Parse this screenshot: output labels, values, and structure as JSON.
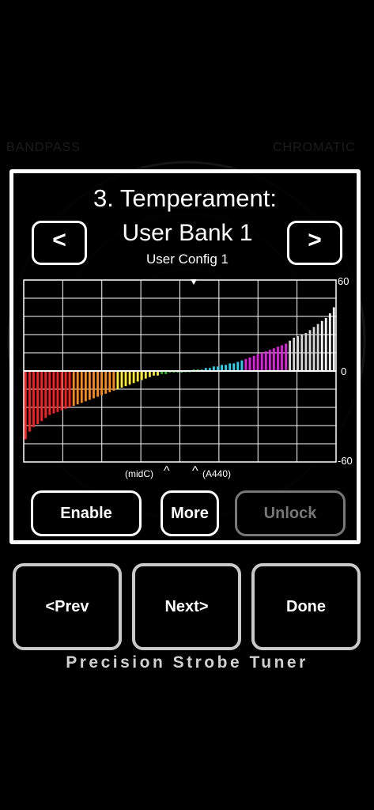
{
  "background": {
    "left_label": "BANDPASS",
    "right_label": "CHROMATIC"
  },
  "dialog": {
    "title": "3. Temperament:",
    "bank_name": "User Bank 1",
    "config_name": "User Config 1",
    "prev_arrow": "<",
    "next_arrow": ">",
    "enable_label": "Enable",
    "more_label": "More",
    "unlock_label": "Unlock"
  },
  "chart_data": {
    "type": "bar",
    "ytick_labels": [
      "60",
      "0",
      "-60"
    ],
    "ylim": [
      -60,
      60
    ],
    "grid": true,
    "marker_labels": [
      "(midC)",
      "(A440)"
    ],
    "bar_count": 78,
    "values": [
      -45,
      -40,
      -37,
      -35,
      -33,
      -31,
      -29,
      -28,
      -27,
      -26,
      -25,
      -24,
      -23,
      -22,
      -21,
      -20,
      -19,
      -18,
      -17,
      -16,
      -15,
      -14,
      -13,
      -12,
      -11,
      -10,
      -9,
      -8,
      -7,
      -6,
      -5,
      -4,
      -3,
      -3,
      -2,
      -2,
      -1,
      -1,
      -1,
      -1,
      0,
      0,
      1,
      1,
      1,
      2,
      2,
      3,
      3,
      4,
      4,
      5,
      5,
      6,
      7,
      8,
      9,
      10,
      11,
      12,
      13,
      14,
      15,
      16,
      17,
      18,
      20,
      22,
      23,
      24,
      25,
      27,
      29,
      31,
      33,
      35,
      38,
      42
    ],
    "series_colors": [
      {
        "color": "#ff1e1e",
        "count": 12
      },
      {
        "color": "#ff8a10",
        "count": 11
      },
      {
        "color": "#ffee22",
        "count": 11
      },
      {
        "color": "#22d41e",
        "count": 10
      },
      {
        "color": "#22d4ee",
        "count": 11
      },
      {
        "color": "#e81ee8",
        "count": 11
      },
      {
        "color": "#d8d8d8",
        "count": 8
      },
      {
        "color": "#ffffff",
        "count": 4
      }
    ]
  },
  "nav": {
    "prev_label": "<Prev",
    "next_label": "Next>",
    "done_label": "Done"
  },
  "footer": {
    "text": "Precision Strobe Tuner"
  }
}
